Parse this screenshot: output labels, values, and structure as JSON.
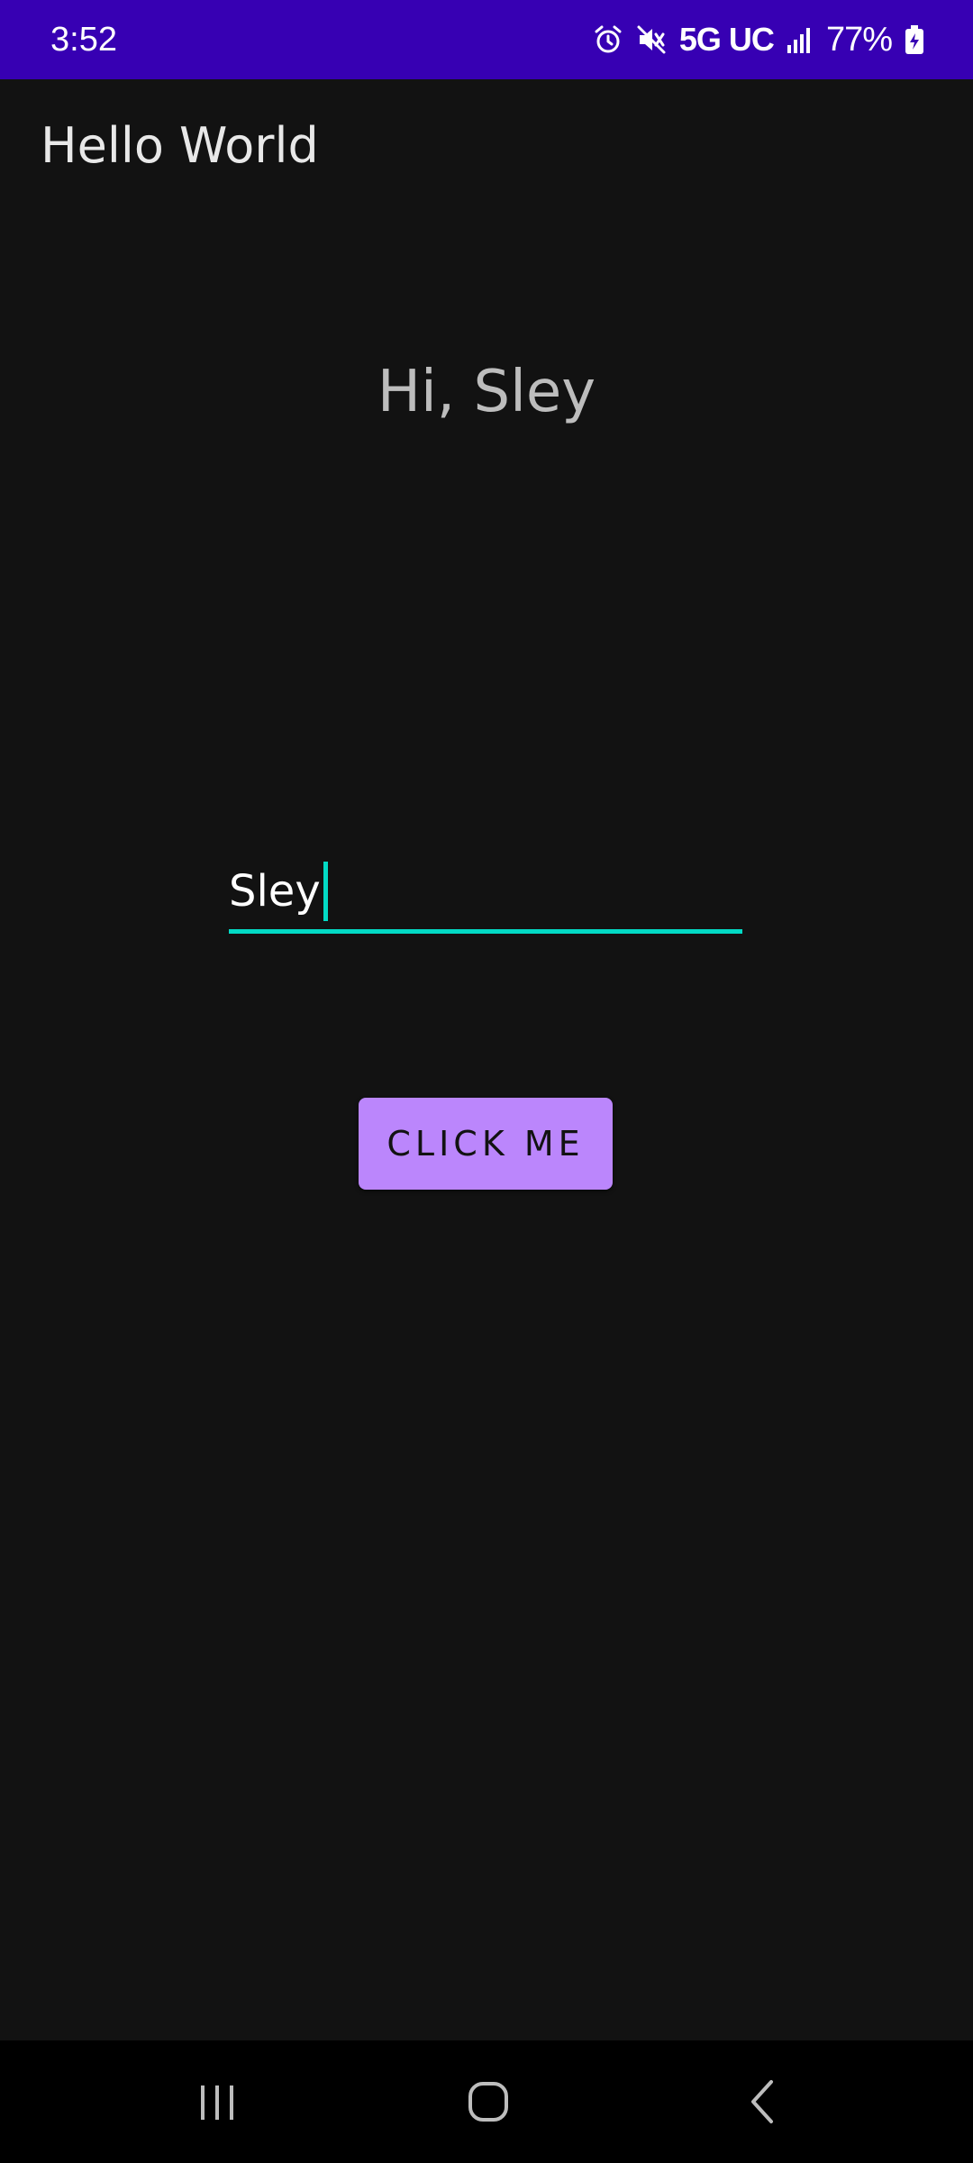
{
  "status_bar": {
    "time": "3:52",
    "network": "5G UC",
    "battery": "77%",
    "icons": [
      "alarm-icon",
      "mute-icon",
      "signal-icon",
      "battery-charging-icon"
    ],
    "background": "#3700B3"
  },
  "app_bar": {
    "title": "Hello World"
  },
  "main": {
    "greeting": "Hi, Sley",
    "name_input_value": "Sley",
    "button_label": "CLICK ME"
  },
  "nav_bar": {
    "icons": [
      "recent-apps-icon",
      "home-icon",
      "back-icon"
    ]
  },
  "colors": {
    "background": "#121212",
    "accent": "#03DAC5",
    "button": "#BB86FC"
  }
}
